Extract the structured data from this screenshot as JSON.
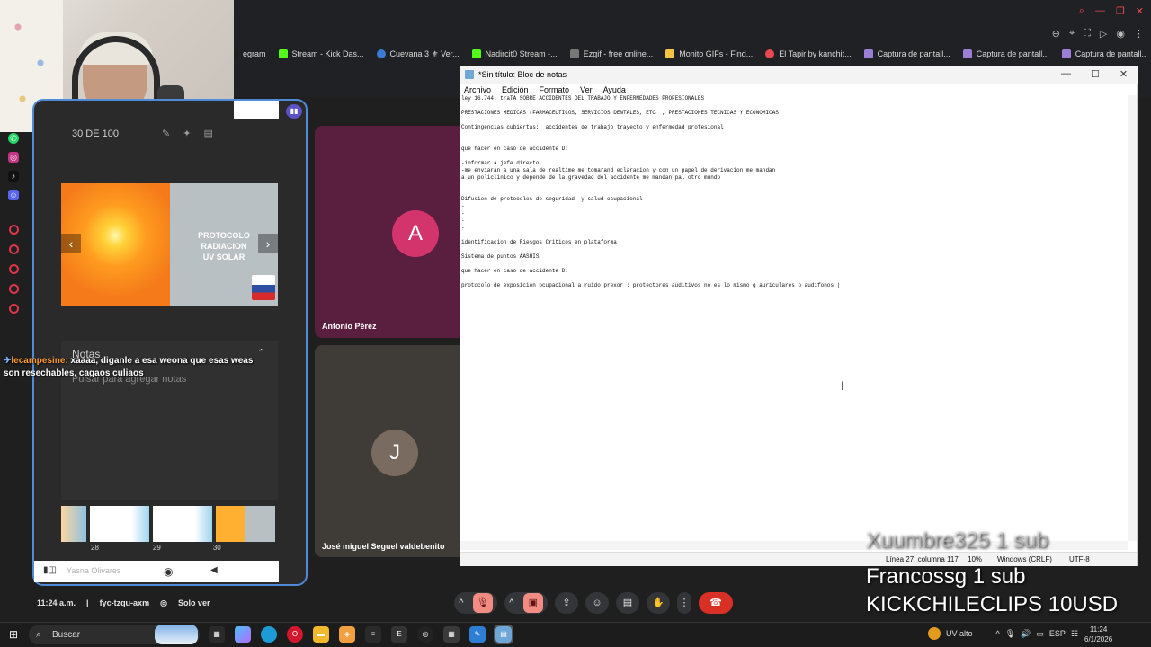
{
  "bookmarks": [
    {
      "label": "egram",
      "color": "#1f1f1f"
    },
    {
      "label": "Stream - Kick Das...",
      "color": "#53fc18"
    },
    {
      "label": "Cuevana 3 ⚜ Ver...",
      "color": "#3a7bd5"
    },
    {
      "label": "Nadircit0 Stream -...",
      "color": "#53fc18"
    },
    {
      "label": "Ezgif - free online...",
      "color": "#777777"
    },
    {
      "label": "Monito GIFs - Find...",
      "color": "#f5c542"
    },
    {
      "label": "El Tapir by kanchit...",
      "color": "#e8484f"
    },
    {
      "label": "Captura de pantall...",
      "color": "#9b7fd6"
    },
    {
      "label": "Captura de pantall...",
      "color": "#9b7fd6"
    },
    {
      "label": "Captura de pantall...",
      "color": "#9b7fd6"
    }
  ],
  "presentation": {
    "slide_counter": "30 DE 100",
    "slide_title": "PROTOCOLO\nRADIACION\nUV SOLAR",
    "notes_title": "Notas",
    "notes_placeholder": "Pulsar para agregar notas",
    "thumbnails": [
      "28",
      "29",
      "30"
    ],
    "presenter_ghost": "Yasna Olivares"
  },
  "chat": {
    "user": "lecampesine:",
    "message": " xaaaa, diganle a esa weona que esas weas son resechables, cagaos culiaos"
  },
  "participants": [
    {
      "initial": "A",
      "name": "Antonio Pérez",
      "color": "#d4346c"
    },
    {
      "initial": "J",
      "name": "José miguel Seguel valdebenito",
      "color": "#7a6b60"
    }
  ],
  "notepad": {
    "title": "*Sin título: Bloc de notas",
    "menu": [
      "Archivo",
      "Edición",
      "Formato",
      "Ver",
      "Ayuda"
    ],
    "lines": [
      "ley 16.744: traTA SOBRE ACCIDENTES DEL TRABAJO Y ENFERMEDADES PROFESIONALES",
      "",
      "PRESTACIONES MEDICAS (FARMACEUTICOS, SERVICIOS DENTALES, ETC  , PRESTACIONES TECNICAS Y ECONOMICAS",
      "",
      "Contingencias cubiertas:  accidentes de trabajo trayecto y enfermedad profesional",
      "",
      "",
      "que hacer en caso de accidente D:",
      "",
      "-informar a jefe directo",
      "-me enviaran a una sala de realtime me tomarand eclaracion y con un papel de derivacion me mandan",
      "a un policlinico y depende de la gravedad del accidente me mandan pal otro mundo",
      "",
      "",
      "Difusion de protocolos de seguridad  y salud ocupacional",
      "-",
      "-",
      "-",
      "-",
      "-",
      "identificacion de Riesgos Criticos en plataforma",
      "",
      "Sistema de puntos AASHIS",
      "",
      "que hacer en caso de accidente D:",
      "",
      "protocolo de exposicion ocupacional a ruido prexor : protectores auditivos no es lo mismo q auriculares o audifonos |"
    ],
    "status": {
      "position": "Línea 27, columna 117",
      "zoom": "10%",
      "eol": "Windows (CRLF)",
      "encoding": "UTF-8"
    }
  },
  "overlay": {
    "ghost": "Xuumbre325 1 sub",
    "line1": "Francossg 1 sub",
    "line2": "KICKCHILECLIPS 10USD"
  },
  "meet_bar": {
    "time": "11:24 a.m.",
    "code": "fyc-tzqu-axm",
    "view_only": "Solo ver"
  },
  "taskbar": {
    "search": "Buscar",
    "weather": "UV alto",
    "lang": "ESP",
    "time": "11:24",
    "date": "6/1/2026"
  }
}
